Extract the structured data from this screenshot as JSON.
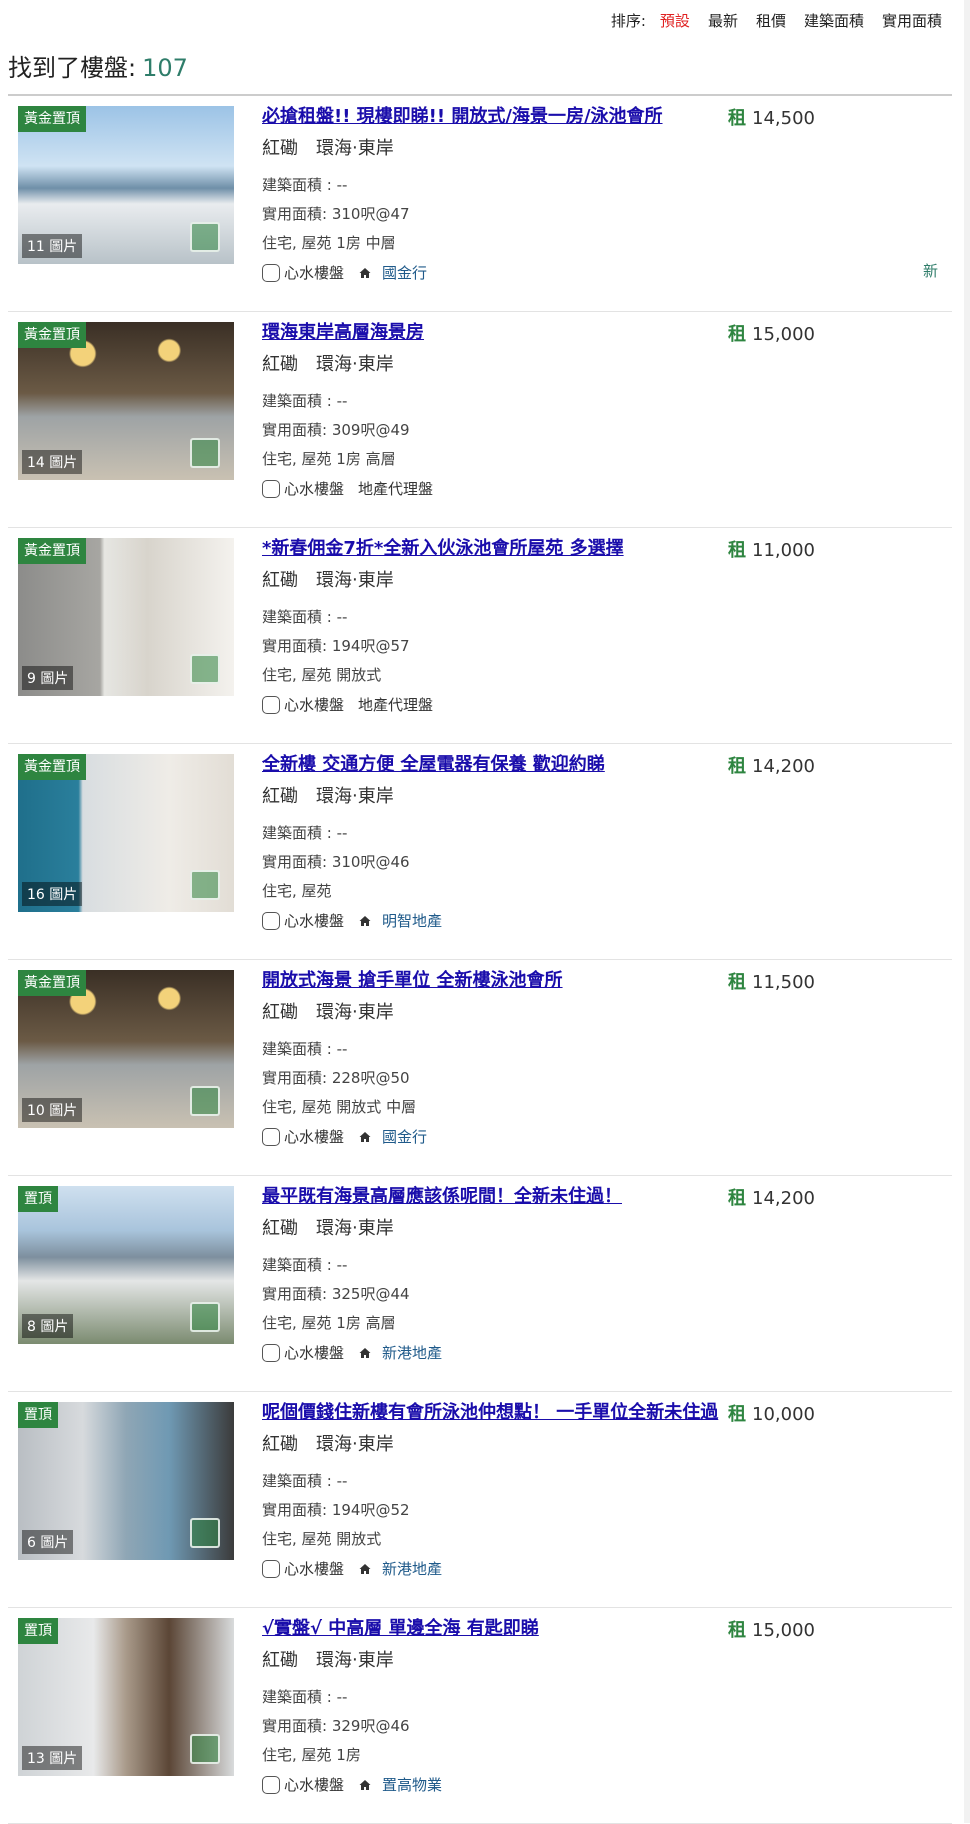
{
  "sort": {
    "label": "排序:",
    "options": [
      "預設",
      "最新",
      "租價",
      "建築面積",
      "實用面積"
    ],
    "active": "預設"
  },
  "found": {
    "label": "找到了樓盤:",
    "count": "107"
  },
  "listings": [
    {
      "badge": "黃金置頂",
      "photos": "11 圖片",
      "title": "必搶租盤!! 現樓即睇!! 開放式/海景一房/泳池會所",
      "district": "紅磡",
      "estate": "環海‧東岸",
      "gross": "建築面積 : --",
      "net": "實用面積: 310呎@47",
      "type": "住宅, 屋苑 1房 中層",
      "fav": "心水樓盤",
      "agent": "國金行",
      "agent_icon": "house-icon",
      "price_label": "租",
      "price": "14,500",
      "new": "新",
      "photo_theme": "sea"
    },
    {
      "badge": "黃金置頂",
      "photos": "14 圖片",
      "title": "環海東岸高層海景房",
      "district": "紅磡",
      "estate": "環海‧東岸",
      "gross": "建築面積 : --",
      "net": "實用面積: 309呎@49",
      "type": "住宅, 屋苑 1房 高層",
      "fav": "心水樓盤",
      "agent": "地產代理盤",
      "agent_icon": "",
      "price_label": "租",
      "price": "15,000",
      "new": "",
      "photo_theme": "lobby"
    },
    {
      "badge": "黃金置頂",
      "photos": "9 圖片",
      "title": "*新春佣金7折*全新入伙泳池會所屋苑 多選擇",
      "district": "紅磡",
      "estate": "環海‧東岸",
      "gross": "建築面積 : --",
      "net": "實用面積: 194呎@57",
      "type": "住宅, 屋苑 開放式",
      "fav": "心水樓盤",
      "agent": "地產代理盤",
      "agent_icon": "",
      "price_label": "租",
      "price": "11,000",
      "new": "",
      "photo_theme": "kitchen"
    },
    {
      "badge": "黃金置頂",
      "photos": "16 圖片",
      "title": "全新樓 交通方便 全屋電器有保養 歡迎約睇",
      "district": "紅磡",
      "estate": "環海‧東岸",
      "gross": "建築面積 : --",
      "net": "實用面積: 310呎@46",
      "type": "住宅, 屋苑",
      "fav": "心水樓盤",
      "agent": "明智地產",
      "agent_icon": "house-icon",
      "price_label": "租",
      "price": "14,200",
      "new": "",
      "photo_theme": "room"
    },
    {
      "badge": "黃金置頂",
      "photos": "10 圖片",
      "title": "開放式海景 搶手單位 全新樓泳池會所",
      "district": "紅磡",
      "estate": "環海‧東岸",
      "gross": "建築面積 : --",
      "net": "實用面積: 228呎@50",
      "type": "住宅, 屋苑 開放式 中層",
      "fav": "心水樓盤",
      "agent": "國金行",
      "agent_icon": "house-icon",
      "price_label": "租",
      "price": "11,500",
      "new": "",
      "photo_theme": "lobby"
    },
    {
      "badge": "置頂",
      "photos": "8 圖片",
      "title": "最平既有海景高層應該係呢間！全新未住過！",
      "district": "紅磡",
      "estate": "環海‧東岸",
      "gross": "建築面積 : --",
      "net": "實用面積: 325呎@44",
      "type": "住宅, 屋苑 1房 高層",
      "fav": "心水樓盤",
      "agent": "新港地產",
      "agent_icon": "house-icon",
      "price_label": "租",
      "price": "14,200",
      "new": "",
      "photo_theme": "city"
    },
    {
      "badge": "置頂",
      "photos": "6 圖片",
      "title": "呢個價錢住新樓有會所泳池仲想點！ 一手單位全新未住過",
      "district": "紅磡",
      "estate": "環海‧東岸",
      "gross": "建築面積 : --",
      "net": "實用面積: 194呎@52",
      "type": "住宅, 屋苑 開放式",
      "fav": "心水樓盤",
      "agent": "新港地產",
      "agent_icon": "house-icon",
      "price_label": "租",
      "price": "10,000",
      "new": "",
      "photo_theme": "tower"
    },
    {
      "badge": "置頂",
      "photos": "13 圖片",
      "title": "√實盤√ 中高層 單邊全海 有匙即睇",
      "district": "紅磡",
      "estate": "環海‧東岸",
      "gross": "建築面積 : --",
      "net": "實用面積: 329呎@46",
      "type": "住宅, 屋苑 1房",
      "fav": "心水樓盤",
      "agent": "置高物業",
      "agent_icon": "house-icon",
      "price_label": "租",
      "price": "15,000",
      "new": "",
      "photo_theme": "hall"
    }
  ],
  "colors": {
    "accent_green": "#2e8540",
    "link_blue": "#1a0dab",
    "active_sort": "#e02020",
    "count_teal": "#2f7d6a"
  }
}
